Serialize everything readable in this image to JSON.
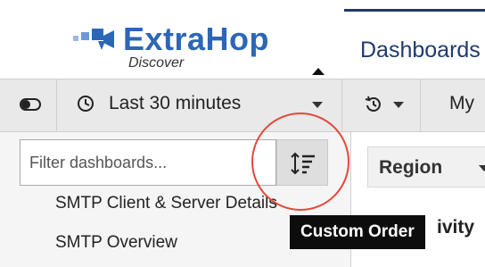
{
  "brand": {
    "name": "ExtraHop",
    "product": "Discover",
    "color": "#2b67b6"
  },
  "nav": {
    "active_tab": "Dashboards"
  },
  "toolbar": {
    "time_range": "Last 30 minutes",
    "my_label": "My"
  },
  "sidebar": {
    "filter_placeholder": "Filter dashboards...",
    "sort_tooltip": "Custom Order",
    "items": [
      {
        "label": "SMTP Client & Server Details"
      },
      {
        "label": "SMTP Overview"
      }
    ]
  },
  "main": {
    "region_label": "Region",
    "partial_heading": "ivity"
  },
  "colors": {
    "highlight_ring": "#e5483c",
    "nav_active": "#1e3b6e",
    "tooltip_bg": "#0d0d0d"
  },
  "icons": {
    "toggle": "toggle-icon",
    "clock": "clock-icon",
    "history": "history-icon",
    "sort": "sort-icon"
  }
}
